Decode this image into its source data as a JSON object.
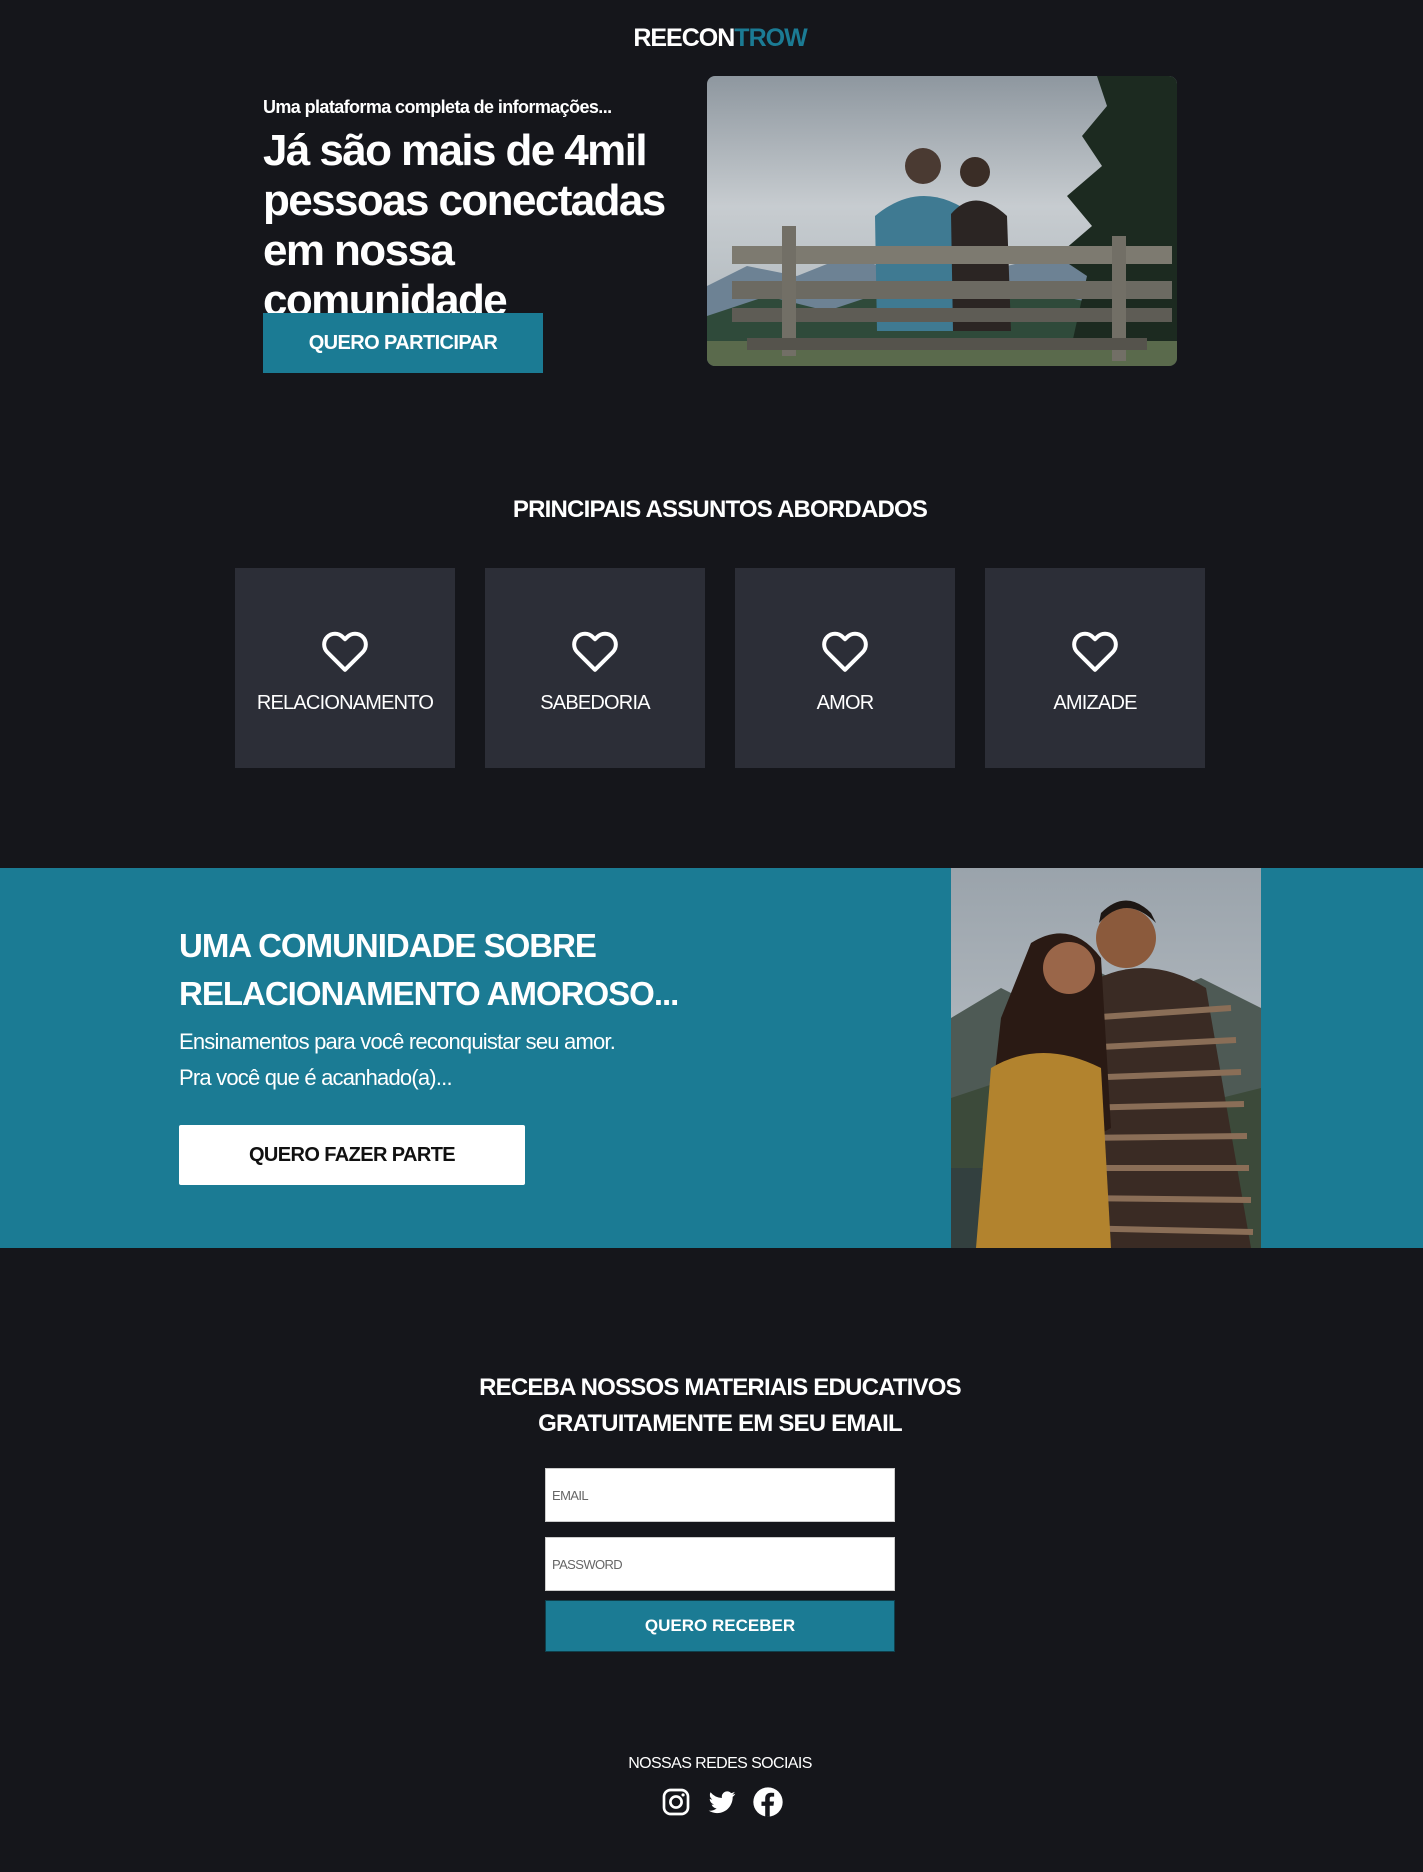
{
  "header": {
    "logo_part1": "REECON",
    "logo_part2": "TROW"
  },
  "hero": {
    "subtitle": "Uma plataforma completa de informações...",
    "title": "Já são mais de 4mil pessoas conectadas em nossa comunidade",
    "cta_label": "QUERO PARTICIPAR"
  },
  "topics": {
    "title": "PRINCIPAIS ASSUNTOS ABORDADOS",
    "items": [
      {
        "label": "RELACIONAMENTO",
        "icon": "heart-icon"
      },
      {
        "label": "SABEDORIA",
        "icon": "heart-icon"
      },
      {
        "label": "AMOR",
        "icon": "heart-icon"
      },
      {
        "label": "AMIZADE",
        "icon": "heart-icon"
      }
    ]
  },
  "community": {
    "title": "UMA COMUNIDADE SOBRE RELACIONAMENTO AMOROSO...",
    "line1": "Ensinamentos para você reconquistar seu amor.",
    "line2": "Pra você que é acanhado(a)...",
    "cta_label": "QUERO FAZER PARTE"
  },
  "newsletter": {
    "title_line1": "RECEBA NOSSOS MATERIAIS EDUCATIVOS",
    "title_line2": "GRATUITAMENTE EM SEU EMAIL",
    "email_placeholder": "EMAIL",
    "password_placeholder": "PASSWORD",
    "submit_label": "QUERO RECEBER"
  },
  "social": {
    "title": "NOSSAS REDES SOCIAIS",
    "icons": [
      "instagram-icon",
      "twitter-icon",
      "facebook-icon"
    ]
  },
  "colors": {
    "background": "#15161b",
    "accent": "#1b7b94",
    "card": "#2c2e37"
  }
}
